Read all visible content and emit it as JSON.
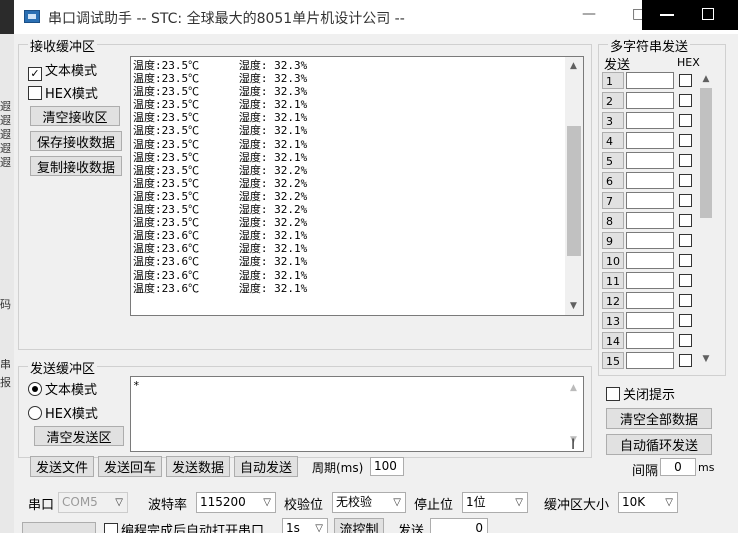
{
  "window": {
    "title": "串口调试助手 -- STC: 全球最大的8051单片机设计公司 --",
    "minimize": "—",
    "maximize": "□"
  },
  "left_strip": [
    "遐",
    "遐",
    "遐",
    "遐",
    "遐",
    "码",
    "串",
    "报"
  ],
  "receive": {
    "group_title": "接收缓冲区",
    "text_mode": "文本模式",
    "hex_mode": "HEX模式",
    "text_mode_checked": "✓",
    "clear_btn": "清空接收区",
    "save_btn": "保存接收数据",
    "copy_btn": "复制接收数据",
    "lines": [
      "温度:23.5℃      湿度: 32.3%",
      "温度:23.5℃      湿度: 32.3%",
      "温度:23.5℃      湿度: 32.3%",
      "温度:23.5℃      湿度: 32.1%",
      "温度:23.5℃      湿度: 32.1%",
      "温度:23.5℃      湿度: 32.1%",
      "温度:23.5℃      湿度: 32.1%",
      "温度:23.5℃      湿度: 32.1%",
      "温度:23.5℃      湿度: 32.2%",
      "温度:23.5℃      湿度: 32.2%",
      "温度:23.5℃      湿度: 32.2%",
      "温度:23.5℃      湿度: 32.2%",
      "温度:23.5℃      湿度: 32.2%",
      "温度:23.6℃      湿度: 32.1%",
      "温度:23.6℃      湿度: 32.1%",
      "温度:23.6℃      湿度: 32.1%",
      "温度:23.6℃      湿度: 32.1%",
      "温度:23.6℃      湿度: 32.1%"
    ],
    "scroll_position": 0.55
  },
  "send": {
    "group_title": "发送缓冲区",
    "text_mode": "文本模式",
    "hex_mode": "HEX模式",
    "clear_btn": "清空发送区",
    "content": "*",
    "send_file_btn": "发送文件",
    "send_return_btn": "发送回车",
    "send_data_btn": "发送数据",
    "auto_send_btn": "自动发送",
    "period_label": "周期(ms)",
    "period_value": "100"
  },
  "multi_send": {
    "title": "多字符串发送",
    "send_col": "发送",
    "hex_col": "HEX",
    "rows": [
      "1",
      "2",
      "3",
      "4",
      "5",
      "6",
      "7",
      "8",
      "9",
      "10",
      "11",
      "12",
      "13",
      "14",
      "15"
    ],
    "close_tip": "关闭提示",
    "clear_all_btn": "清空全部数据",
    "auto_loop_btn": "自动循环发送",
    "interval_label": "间隔",
    "interval_value": "0",
    "interval_unit": "ms"
  },
  "settings": {
    "port_label": "串口",
    "port_value": "COM5",
    "baud_label": "波特率",
    "baud_value": "115200",
    "parity_label": "校验位",
    "parity_value": "无校验",
    "stop_label": "停止位",
    "stop_value": "1位",
    "buffer_label": "缓冲区大小",
    "buffer_value": "10K",
    "auto_open_label": "编程完成后自动打开串口",
    "timeout_value": "1s",
    "flow_btn": "流控制",
    "send_count_label": "发送",
    "send_count_value": "0"
  }
}
